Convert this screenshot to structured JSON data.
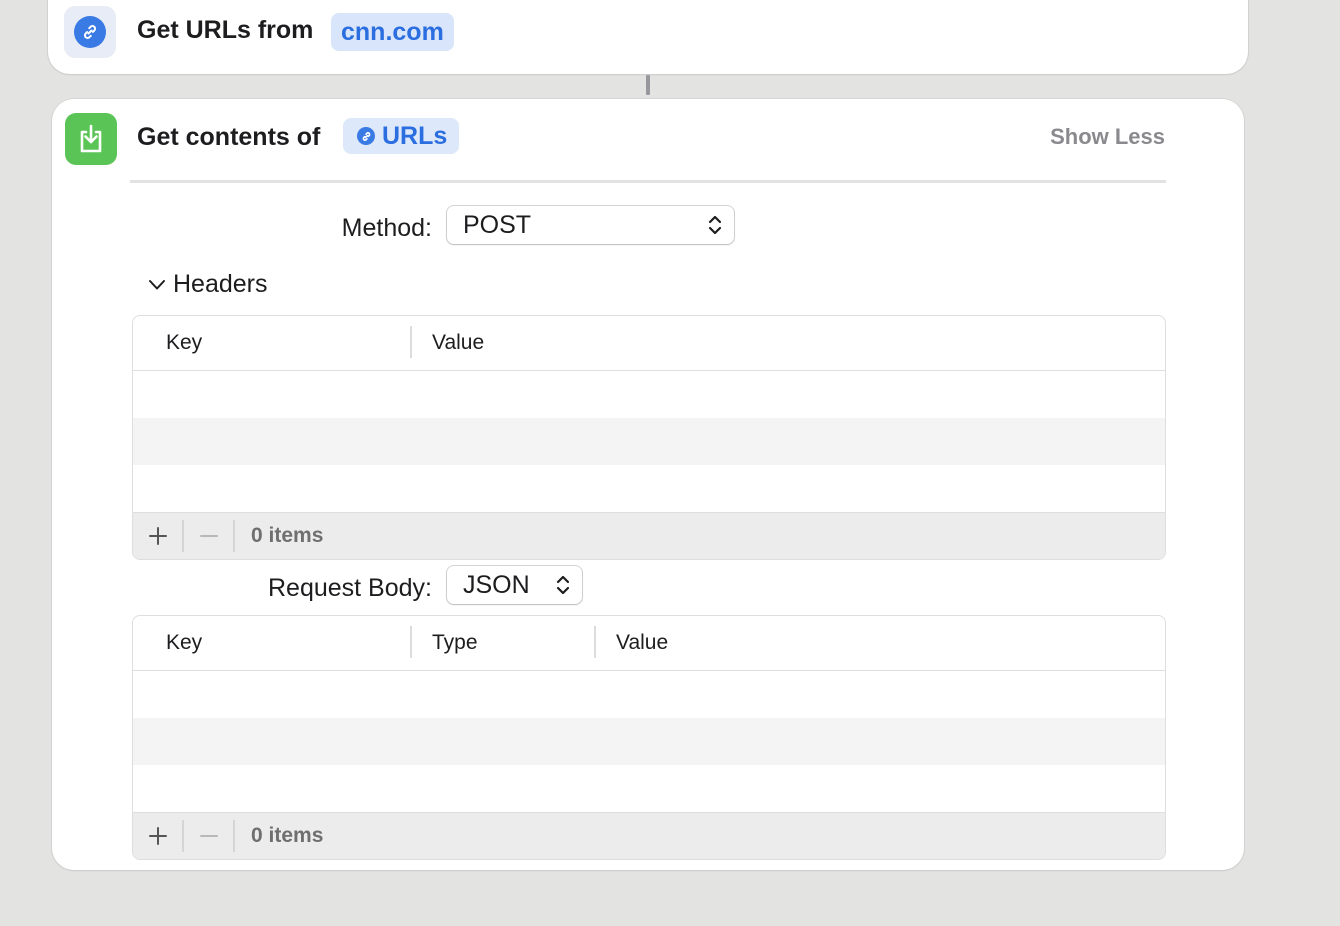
{
  "action1": {
    "title": "Get URLs from",
    "token": "cnn.com",
    "icon": "link-icon"
  },
  "action2": {
    "title": "Get contents of",
    "token": "URLs",
    "token_icon": "link-icon",
    "icon": "download-icon",
    "show_less": "Show Less",
    "method": {
      "label": "Method:",
      "value": "POST"
    },
    "headers": {
      "label": "Headers",
      "columns": [
        "Key",
        "Value"
      ],
      "count": "0 items"
    },
    "request_body": {
      "label": "Request Body:",
      "value": "JSON",
      "columns": [
        "Key",
        "Type",
        "Value"
      ],
      "count": "0 items"
    }
  },
  "colors": {
    "accent": "#3a7ae4",
    "action_green": "#5bc456",
    "token_bg": "#d9e5fb",
    "background": "#e3e3e2"
  }
}
